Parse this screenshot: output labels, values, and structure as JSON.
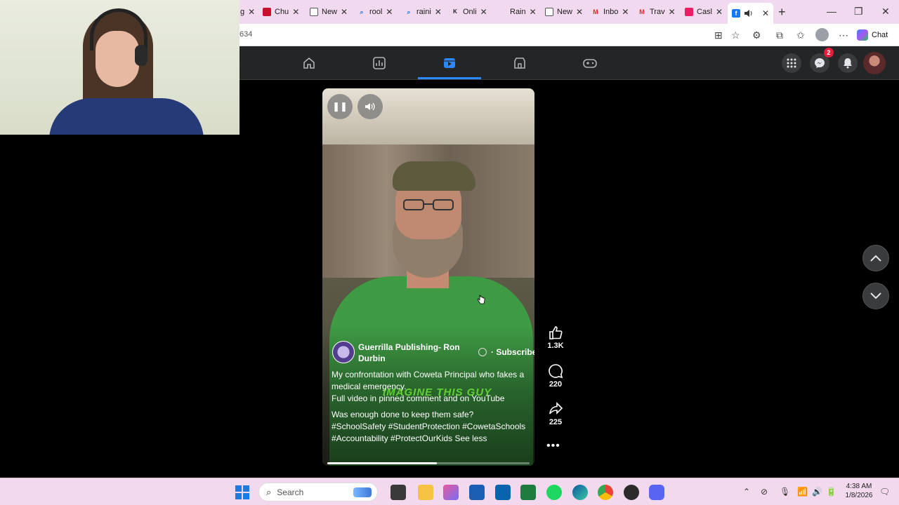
{
  "browser": {
    "tabs": [
      {
        "label": "g",
        "color": "#888888",
        "icon": "tab-partial-icon"
      },
      {
        "label": "Chu",
        "color": "#c8102e",
        "icon": "crunchyroll-icon"
      },
      {
        "label": "New",
        "color": "#555555",
        "icon": "newtab-icon"
      },
      {
        "label": "rool",
        "color": "#1a73e8",
        "icon": "search-icon"
      },
      {
        "label": "raini",
        "color": "#1a73e8",
        "icon": "search-icon"
      },
      {
        "label": "Onli",
        "color": "#222222",
        "icon": "doc-icon"
      },
      {
        "label": "Rain",
        "color": "#888888",
        "icon": "page-icon"
      },
      {
        "label": "New",
        "color": "#555555",
        "icon": "newtab-icon"
      },
      {
        "label": "Inbo",
        "color": "#d93025",
        "icon": "gmail-icon"
      },
      {
        "label": "Trav",
        "color": "#d93025",
        "icon": "gmail-icon"
      },
      {
        "label": "Casl",
        "color": "#e91e63",
        "icon": "app-icon"
      }
    ],
    "url_fragment": "634",
    "chat_label": "Chat"
  },
  "facebook": {
    "messenger_badge": "2",
    "active_nav": "reels"
  },
  "reel": {
    "author": "Guerrilla Publishing- Ron Durbin",
    "subscribe_label": "· Subscribe",
    "caption_lines": [
      "My confrontation with Coweta Principal who fakes a medical emergency.",
      "Full video in pinned comment and on YouTube"
    ],
    "caption_question": "Was enough done to keep them safe?",
    "hashtags": "#SchoolSafety #StudentProtection #CowetaSchools #Accountability #ProtectOurKids",
    "see_less": "See less",
    "burned_caption": "IMAGINE THIS GUY",
    "progress": 0.54
  },
  "actions": {
    "likes": "1.3K",
    "comments": "220",
    "shares": "225"
  },
  "taskbar": {
    "search_label": "Search",
    "time": "4:38 AM",
    "date": "1/8/2026"
  }
}
